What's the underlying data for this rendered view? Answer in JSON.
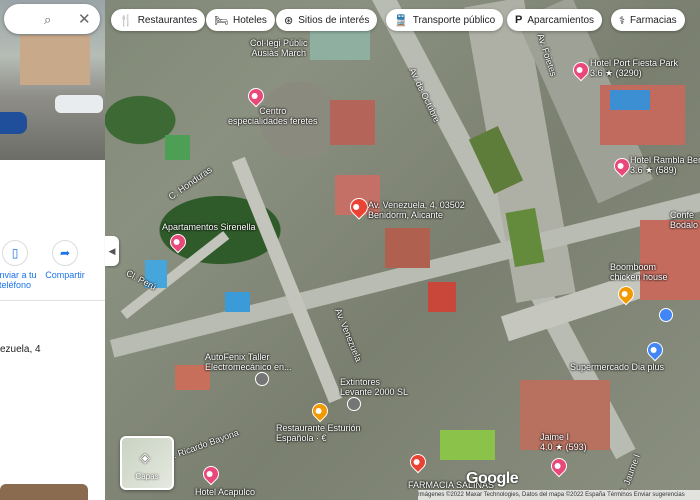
{
  "search": {
    "search_icon": "search-icon",
    "close_icon": "close-icon"
  },
  "panel": {
    "actions": [
      {
        "icon": "phone-icon",
        "label_line1": "Enviar a tu",
        "label_line2": "teléfono"
      },
      {
        "icon": "share-icon",
        "label_line1": "Compartir",
        "label_line2": ""
      }
    ],
    "address_fragment": "ezuela, 4"
  },
  "chips": [
    {
      "icon": "restaurant-icon",
      "label": "Restaurantes"
    },
    {
      "icon": "hotel-icon",
      "label": "Hoteles"
    },
    {
      "icon": "attraction-icon",
      "label": "Sitios de interés"
    },
    {
      "icon": "transit-icon",
      "label": "Transporte público"
    },
    {
      "icon": "parking-icon",
      "label": "Aparcamientos"
    },
    {
      "icon": "pharmacy-icon",
      "label": "Farmacias"
    }
  ],
  "map": {
    "places": [
      {
        "line1": "Col·legi Públic",
        "line2": "Ausiàs March"
      },
      {
        "line1": "Centro",
        "line2": "especialidades feretes"
      },
      {
        "line1": "Apartamentos Sirenella",
        "line2": ""
      },
      {
        "line1": "Av. Venezuela, 4, 03502",
        "line2": "Benidorm, Alicante"
      },
      {
        "line1": "Hotel Port Fiesta Park",
        "line2": "3.6 ★ (3290)"
      },
      {
        "line1": "Hotel Rambla Benidorm",
        "line2": "3.6 ★ (589)"
      },
      {
        "line1": "Confe",
        "line2": "Bodalo S"
      },
      {
        "line1": "Boomboom",
        "line2": "chicken house"
      },
      {
        "line1": "Supermercado Dia plus",
        "line2": ""
      },
      {
        "line1": "AutoFenix Taller",
        "line2": "Electromecánico en..."
      },
      {
        "line1": "Extintores",
        "line2": "Levante 2000 SL"
      },
      {
        "line1": "Restaurante Esturión",
        "line2": "Española · €"
      },
      {
        "line1": "Jaime I",
        "line2": "4.0 ★ (593)"
      },
      {
        "line1": "FARMACIA SALINAS",
        "line2": ""
      },
      {
        "line1": "Hotel Acapulco",
        "line2": ""
      }
    ],
    "streets": [
      "Av. de Europa",
      "Av. de Octubre",
      "Av. Foietes",
      "C. Honduras",
      "Cl. Perú",
      "Av. Venezuela",
      "C. Ricardo Bayona",
      "C. Jaume I"
    ]
  },
  "layers": {
    "icon": "layers-icon",
    "label": "Capas"
  },
  "branding": {
    "logo": "Google"
  },
  "footer": {
    "text": "Imágenes ©2022 Maxar Technologies, Datos del mapa ©2022   España   Términos   Enviar sugerencias"
  },
  "colors": {
    "pin_red": "#ea4335",
    "pin_pink": "#e8487a",
    "pin_orange": "#f29900",
    "pin_blue": "#4285f4",
    "pin_gray": "#757575",
    "link_blue": "#1a73e8"
  }
}
